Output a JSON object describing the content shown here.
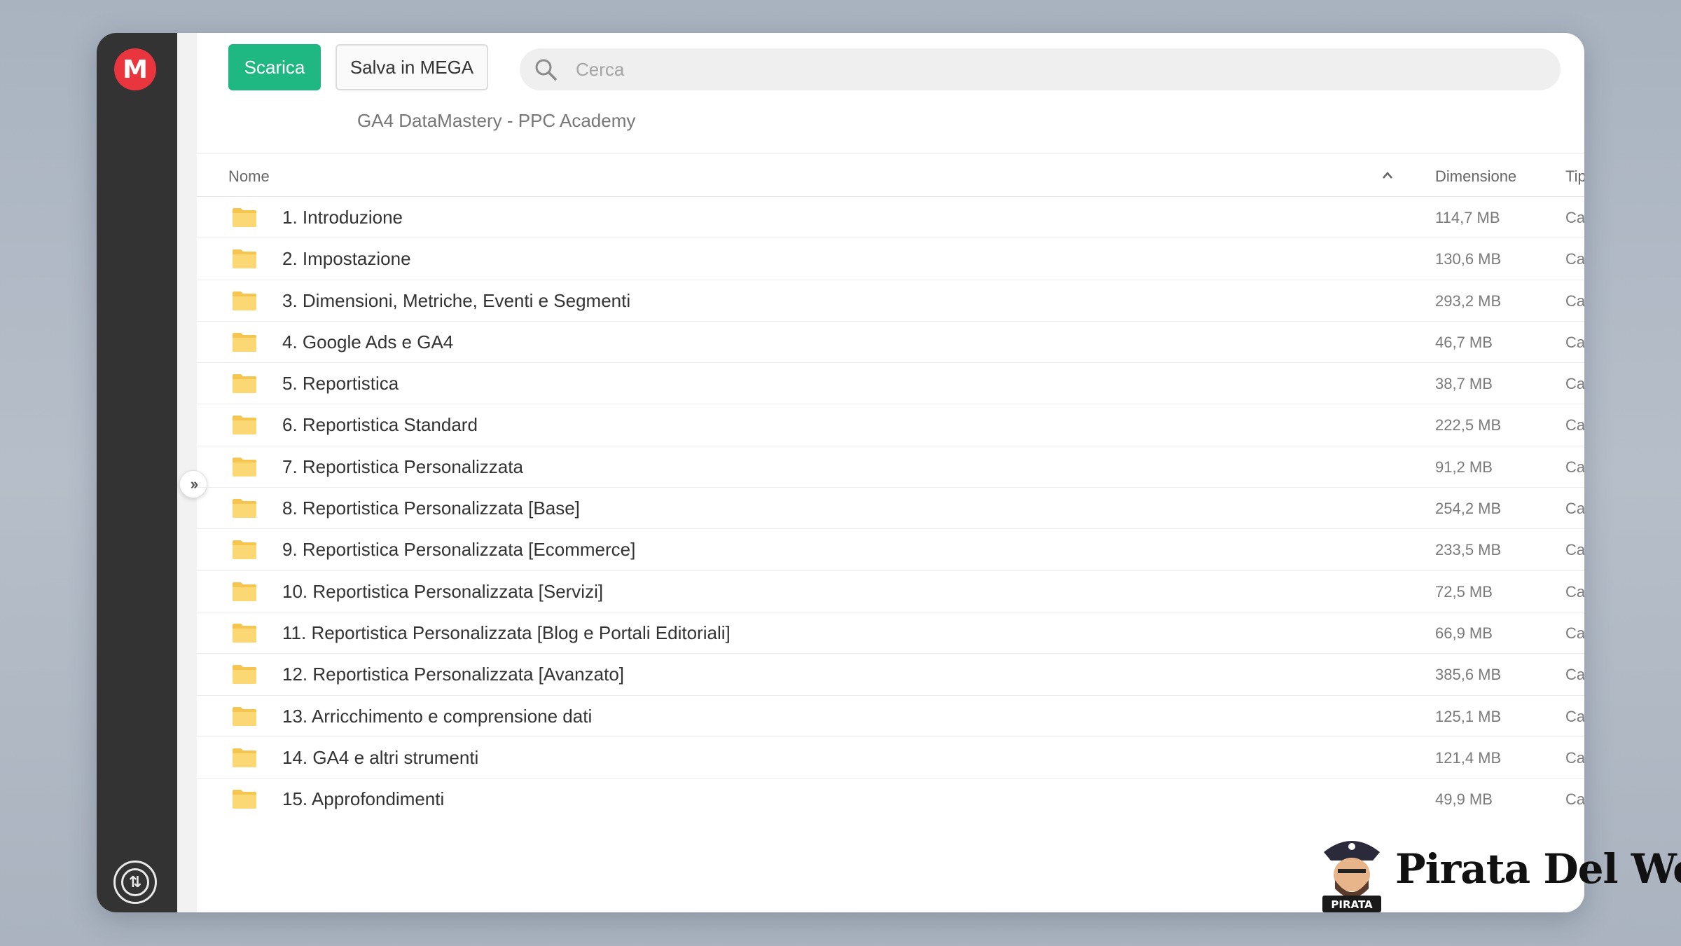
{
  "toolbar": {
    "download_label": "Scarica",
    "save_label": "Salva in MEGA"
  },
  "search": {
    "placeholder": "Cerca",
    "value": ""
  },
  "breadcrumb": "GA4 DataMastery - PPC Academy",
  "sidebar": {
    "logo": "M",
    "expand_icon": "chevron-double-right-icon",
    "transfer_icon": "transfer-icon"
  },
  "table": {
    "headers": {
      "name": "Nome",
      "size": "Dimensione",
      "type": "Tipo",
      "sort_indicator": "^"
    },
    "rows": [
      {
        "name": "1. Introduzione",
        "size": "114,7 MB",
        "type": "Cartella"
      },
      {
        "name": "2. Impostazione",
        "size": "130,6 MB",
        "type": "Cartella"
      },
      {
        "name": "3. Dimensioni, Metriche, Eventi e Segmenti",
        "size": "293,2 MB",
        "type": "Cartella"
      },
      {
        "name": "4. Google Ads e GA4",
        "size": "46,7 MB",
        "type": "Cartella"
      },
      {
        "name": "5. Reportistica",
        "size": "38,7 MB",
        "type": "Cartella"
      },
      {
        "name": "6. Reportistica Standard",
        "size": "222,5 MB",
        "type": "Cartella"
      },
      {
        "name": "7. Reportistica Personalizzata",
        "size": "91,2 MB",
        "type": "Cartella"
      },
      {
        "name": "8. Reportistica Personalizzata [Base]",
        "size": "254,2 MB",
        "type": "Cartella"
      },
      {
        "name": "9. Reportistica Personalizzata [Ecommerce]",
        "size": "233,5 MB",
        "type": "Cartella"
      },
      {
        "name": "10. Reportistica Personalizzata [Servizi]",
        "size": "72,5 MB",
        "type": "Cartella"
      },
      {
        "name": "11. Reportistica Personalizzata [Blog e Portali Editoriali]",
        "size": "66,9 MB",
        "type": "Cartella"
      },
      {
        "name": "12. Reportistica Personalizzata [Avanzato]",
        "size": "385,6 MB",
        "type": "Cartella"
      },
      {
        "name": "13. Arricchimento e comprensione dati",
        "size": "125,1 MB",
        "type": "Cartella"
      },
      {
        "name": "14. GA4 e altri strumenti",
        "size": "121,4 MB",
        "type": "Cartella"
      },
      {
        "name": "15. Approfondimenti",
        "size": "49,9 MB",
        "type": "Cartella"
      }
    ]
  },
  "watermark": {
    "text": "Pirata Del Web",
    "badge": "PIRATA"
  },
  "colors": {
    "accent": "#1fb882",
    "brand": "#e9363e",
    "sidebar": "#333333",
    "folder": "#f5c54f"
  }
}
